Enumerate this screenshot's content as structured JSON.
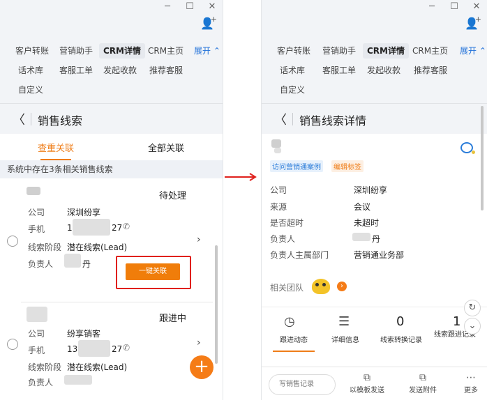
{
  "left": {
    "window": {
      "minimize": "─",
      "maximize": "☐",
      "close": "✕"
    },
    "tabs": [
      "客户转账",
      "营销助手",
      "CRM详情",
      "CRM主页",
      "话术库",
      "客服工单",
      "发起收款",
      "推荐客服",
      "自定义"
    ],
    "expand_label": "展开 ⌃",
    "header_title": "销售线索",
    "back_icon": "〈",
    "subtab_active": "查重关联",
    "subtab_other": "全部关联",
    "notice": "系统中存在3条相关销售线索",
    "cards": [
      {
        "status": "待处理",
        "company_label": "公司",
        "company": "深圳纷享",
        "phone_label": "手机",
        "phone_prefix": "1",
        "phone_suffix": "27",
        "stage_label": "线索阶段",
        "stage": "潜在线索(Lead)",
        "owner_label": "负责人",
        "owner_suffix": "丹",
        "action": "一键关联"
      },
      {
        "status": "跟进中",
        "company_label": "公司",
        "company": "纷享销客",
        "phone_label": "手机",
        "phone_prefix": "13",
        "phone_suffix": "27",
        "stage_label": "线索阶段",
        "stage": "潜在线索(Lead)",
        "owner_label": "负责人"
      }
    ],
    "fab": "+"
  },
  "right": {
    "window": {
      "minimize": "─",
      "maximize": "☐",
      "close": "✕"
    },
    "tabs": [
      "客户转账",
      "营销助手",
      "CRM详情",
      "CRM主页",
      "话术库",
      "客服工单",
      "发起收款",
      "推荐客服",
      "自定义"
    ],
    "expand_label": "展开 ⌃",
    "header_title": "销售线索详情",
    "back_icon": "〈",
    "tags": [
      "访问营销通案例",
      "编辑标签"
    ],
    "fields": [
      {
        "label": "公司",
        "value": "深圳纷享"
      },
      {
        "label": "来源",
        "value": "会议"
      },
      {
        "label": "是否超时",
        "value": "未超时"
      },
      {
        "label": "负责人",
        "value": "丹"
      },
      {
        "label": "负责人主属部门",
        "value": "营销通业务部"
      }
    ],
    "team_label": "相关团队",
    "team_more": "›",
    "stats": [
      {
        "icon": "◷",
        "label": "跟进动态"
      },
      {
        "icon": "☰",
        "label": "详细信息"
      },
      {
        "num": "0",
        "label": "线索转换记录"
      },
      {
        "num": "1",
        "label": "线索跟进记录"
      }
    ],
    "bottom": {
      "write": "写销售记录",
      "items": [
        {
          "icon": "⧉",
          "label": "以模板发送"
        },
        {
          "icon": "⧉",
          "label": "发送附件"
        },
        {
          "icon": "⋯",
          "label": "更多"
        }
      ]
    },
    "side_refresh": "↻",
    "side_down": "⌄"
  }
}
